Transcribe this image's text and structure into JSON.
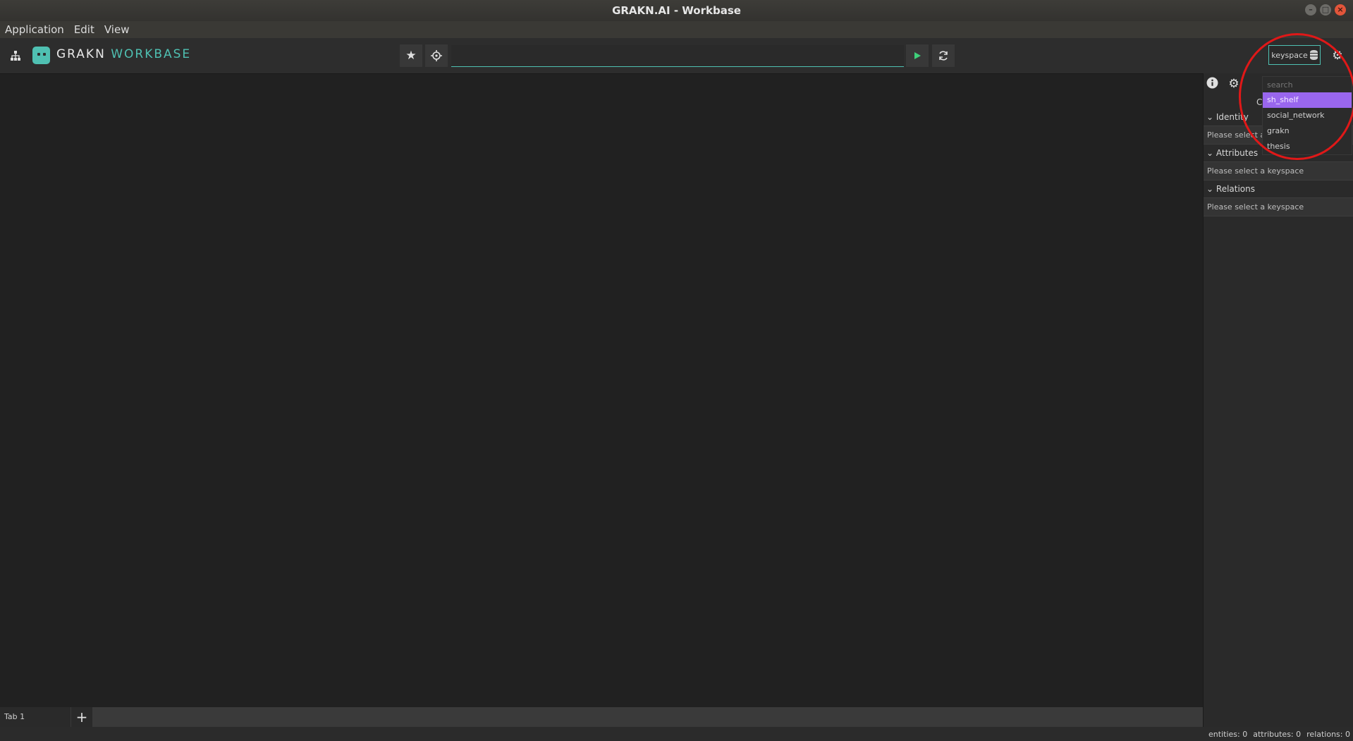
{
  "window": {
    "title": "GRAKN.AI - Workbase",
    "minimize": "–",
    "maximize": "□",
    "close": "×"
  },
  "menu": {
    "items": [
      "Application",
      "Edit",
      "View"
    ]
  },
  "toolbar": {
    "logo_text_main": "GRAKN",
    "logo_text_accent": "WORKBASE",
    "query_value": "",
    "keyspace_label": "keyspace",
    "icons": {
      "schema": "sitemap-icon",
      "favorites": "star-icon",
      "locate": "crosshair-icon",
      "run": "play-icon",
      "refresh": "refresh-icon",
      "settings": "gear-icon"
    }
  },
  "keyspace_dropdown": {
    "search_placeholder": "search",
    "items": [
      "sh_shelf",
      "social_network",
      "grakn",
      "thesis"
    ],
    "selected_index": 0
  },
  "right_panel": {
    "tab_label_partial": "C",
    "sections": [
      {
        "title": "Identity",
        "body": "Please select a keyspace"
      },
      {
        "title": "Attributes",
        "body": "Please select a keyspace"
      },
      {
        "title": "Relations",
        "body": "Please select a keyspace"
      }
    ]
  },
  "tabs": {
    "items": [
      "Tab 1"
    ],
    "add_label": "+"
  },
  "status": {
    "entities": "entities: 0",
    "attributes": "attributes: 0",
    "relations": "relations: 0"
  },
  "colors": {
    "accent": "#4fc0b2",
    "selected": "#9966ee",
    "highlight": "#e01818"
  }
}
